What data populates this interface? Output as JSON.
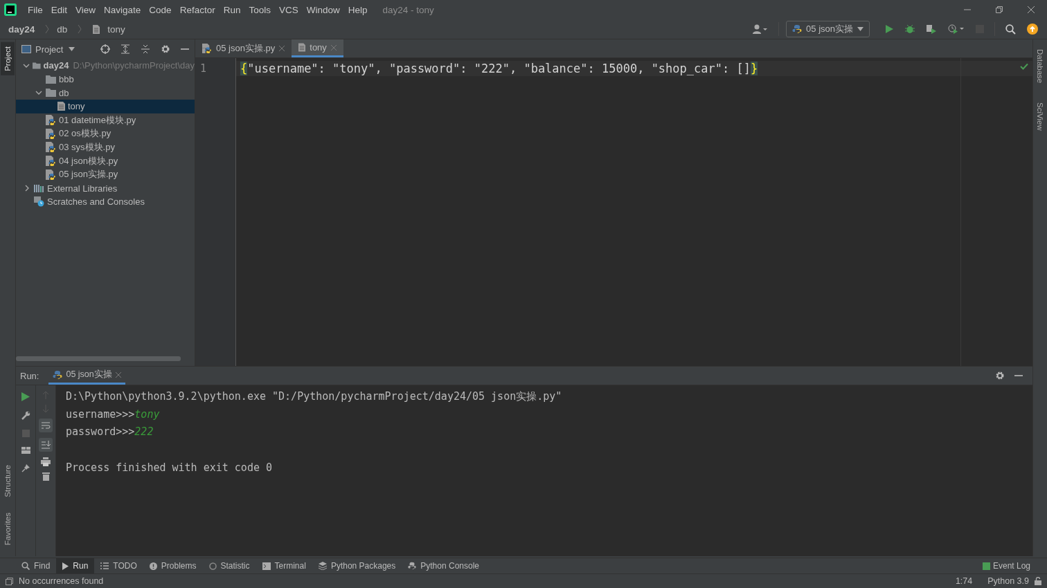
{
  "menu": [
    "File",
    "Edit",
    "View",
    "Navigate",
    "Code",
    "Refactor",
    "Run",
    "Tools",
    "VCS",
    "Window",
    "Help"
  ],
  "window": {
    "title": "day24 - tony"
  },
  "breadcrumbs": [
    "day24",
    "db",
    "tony"
  ],
  "run_config": "05 json实操",
  "left_stripe": [
    {
      "label": "Project",
      "selected": true
    },
    {
      "label": "Structure",
      "selected": false
    },
    {
      "label": "Favorites",
      "selected": false
    }
  ],
  "right_stripe": [
    "Database",
    "SciView"
  ],
  "project_panel": {
    "title": "Project",
    "tree": [
      {
        "name": "day24",
        "path": "D:\\Python\\pycharmProject\\day",
        "kind": "folder",
        "expanded": true,
        "selected": false,
        "children": [
          {
            "name": "bbb",
            "kind": "folder",
            "selected": false
          },
          {
            "name": "db",
            "kind": "folder",
            "expanded": true,
            "selected": false,
            "children": [
              {
                "name": "tony",
                "kind": "text",
                "selected": true
              }
            ]
          },
          {
            "name": "01 datetime模块.py",
            "kind": "python",
            "selected": false
          },
          {
            "name": "02 os模块.py",
            "kind": "python",
            "selected": false
          },
          {
            "name": "03 sys模块.py",
            "kind": "python",
            "selected": false
          },
          {
            "name": "04 json模块.py",
            "kind": "python",
            "selected": false
          },
          {
            "name": "05 json实操.py",
            "kind": "python",
            "selected": false
          }
        ]
      },
      {
        "name": "External Libraries",
        "kind": "library",
        "expanded": false,
        "selected": false
      },
      {
        "name": "Scratches and Consoles",
        "kind": "scratch",
        "selected": false
      }
    ]
  },
  "editor_tabs": [
    {
      "label": "05 json实操.py",
      "kind": "python",
      "selected": false
    },
    {
      "label": "tony",
      "kind": "text",
      "selected": true
    }
  ],
  "editor": {
    "lines": [
      {
        "number": "1",
        "open": "{",
        "body": "\"username\": \"tony\", \"password\": \"222\", \"balance\": 15000, \"shop_car\": []",
        "close": "}"
      }
    ]
  },
  "run_panel": {
    "label": "Run:",
    "tab": "05 json实操",
    "output": [
      {
        "kind": "command",
        "text": "D:\\Python\\python3.9.2\\python.exe \"D:/Python/pycharmProject/day24/05 json实操.py\""
      },
      {
        "kind": "prompt",
        "text": "username>>>",
        "input": "tony"
      },
      {
        "kind": "prompt",
        "text": "password>>>",
        "input": "222"
      },
      {
        "kind": "blank"
      },
      {
        "kind": "info",
        "text": "Process finished with exit code 0"
      }
    ]
  },
  "tool_tabs": [
    {
      "label": "Find",
      "kind": "search",
      "selected": false
    },
    {
      "label": "Run",
      "kind": "run",
      "selected": true
    },
    {
      "label": "TODO",
      "kind": "list",
      "selected": false
    },
    {
      "label": "Problems",
      "kind": "info",
      "selected": false
    },
    {
      "label": "Statistic",
      "kind": "stat",
      "selected": false
    },
    {
      "label": "Terminal",
      "kind": "terminal",
      "selected": false
    },
    {
      "label": "Python Packages",
      "kind": "packages",
      "selected": false
    },
    {
      "label": "Python Console",
      "kind": "python",
      "selected": false
    }
  ],
  "event_log": "Event Log",
  "status_bar": {
    "message": "No occurrences found",
    "position": "1:74",
    "interpreter": "Python 3.9"
  }
}
